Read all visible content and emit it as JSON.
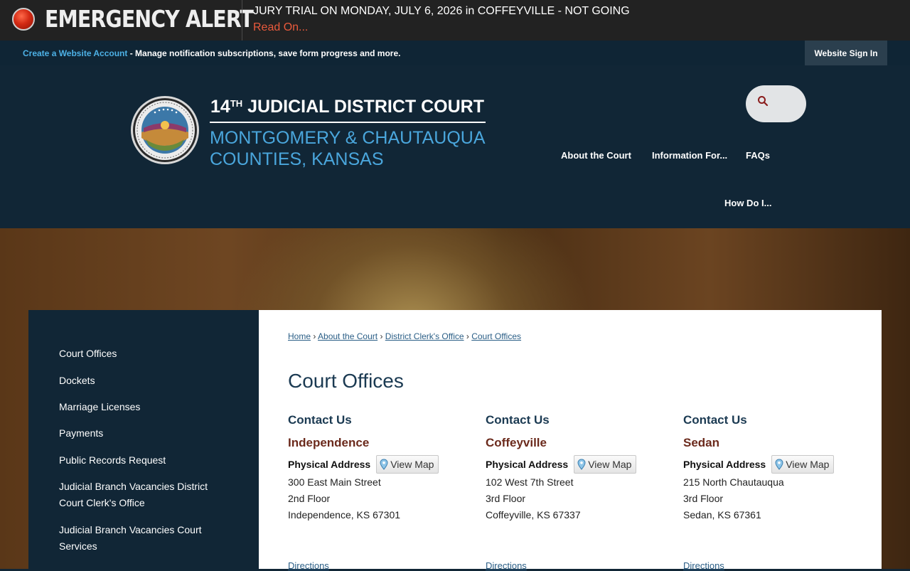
{
  "alert": {
    "title": "EMERGENCY ALERT",
    "message": "JURY TRIAL ON MONDAY, JULY 6, 2026 in COFFEYVILLE - NOT GOING",
    "read_on": "Read On..."
  },
  "account_bar": {
    "create_link": "Create a Website Account",
    "description": " - Manage notification subscriptions, save form progress and more.",
    "sign_in": "Website Sign In"
  },
  "header": {
    "logo_number": "14",
    "logo_suffix": "TH",
    "logo_court": "JUDICIAL DISTRICT COURT",
    "logo_counties_1": "MONTGOMERY & CHAUTAUQUA",
    "logo_counties_2": "COUNTIES, KANSAS",
    "nav": [
      "About the Court",
      "Information For...",
      "FAQs",
      "How Do I..."
    ]
  },
  "sidebar": {
    "items": [
      "Court Offices",
      "Dockets",
      "Marriage Licenses",
      "Payments",
      "Public Records Request",
      "Judicial Branch Vacancies District Court Clerk's Office",
      "Judicial Branch Vacancies Court Services"
    ]
  },
  "breadcrumb": [
    "Home",
    "About the Court",
    "District Clerk's Office",
    "Court Offices"
  ],
  "breadcrumb_sep": "›",
  "page_title": "Court Offices",
  "offices": [
    {
      "heading": "Contact Us",
      "name": "Independence",
      "address_label": "Physical Address",
      "map_label": "View Map",
      "lines": [
        "300 East Main Street",
        "2nd Floor",
        "Independence, KS 67301"
      ],
      "directions": "Directions"
    },
    {
      "heading": "Contact Us",
      "name": "Coffeyville",
      "address_label": "Physical Address",
      "map_label": "View Map",
      "lines": [
        "102 West 7th Street",
        "3rd Floor",
        "Coffeyville, KS 67337"
      ],
      "directions": "Directions"
    },
    {
      "heading": "Contact Us",
      "name": "Sedan",
      "address_label": "Physical Address",
      "map_label": "View Map",
      "lines": [
        "215 North Chautauqua",
        "3rd Floor",
        "Sedan, KS 67361"
      ],
      "directions": "Directions"
    }
  ],
  "icons": {
    "alert": "alert-dot-icon",
    "search": "search-icon",
    "map": "map-pin-icon",
    "seal": "kansas-seal-icon"
  },
  "colors": {
    "alert_bg": "#222222",
    "read_on": "#ea5a3c",
    "header_bg": "#112636",
    "link_blue": "#4db1e6",
    "heading_navy": "#1b3a52",
    "office_name": "#6b2a1c"
  }
}
